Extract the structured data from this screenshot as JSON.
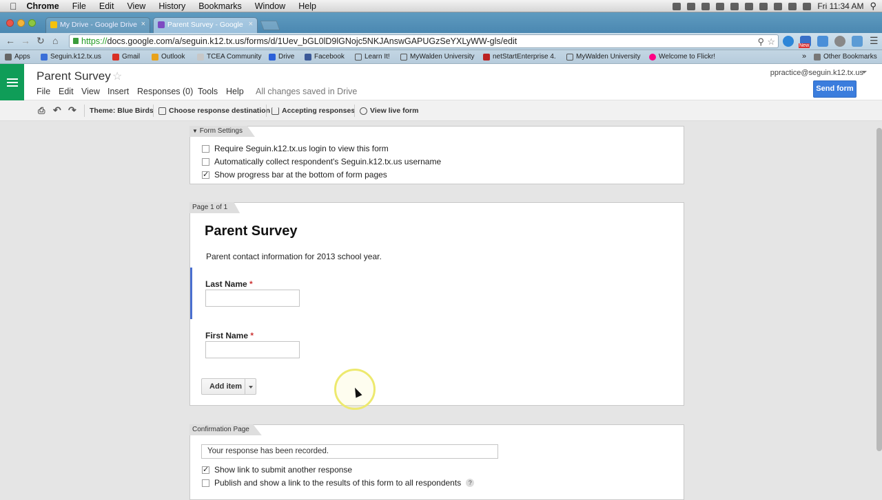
{
  "mac_menu": {
    "app": "Chrome",
    "items": [
      "File",
      "Edit",
      "View",
      "History",
      "Bookmarks",
      "Window",
      "Help"
    ],
    "clock": "Fri 11:34 AM"
  },
  "tabs": [
    {
      "label": "My Drive - Google Drive",
      "active": false
    },
    {
      "label": "Parent Survey - Google",
      "active": true
    }
  ],
  "address": {
    "scheme": "https://",
    "url": "docs.google.com/a/seguin.k12.tx.us/forms/d/1Uev_bGL0lD9lGNojc5NKJAnswGAPUGzSeYXLyWW-gls/edit"
  },
  "extensions": {
    "badge": "New"
  },
  "bookmarks": [
    "Apps",
    "Seguin.k12.tx.us",
    "Gmail",
    "Outlook",
    "TCEA Community",
    "Drive",
    "Facebook",
    "Learn It!",
    "MyWalden University",
    "netStartEnterprise 4.",
    "MyWalden University",
    "Welcome to Flickr!"
  ],
  "bookmarks_overflow": "»",
  "other_bookmarks": "Other Bookmarks",
  "doc": {
    "title": "Parent Survey",
    "menus": [
      "File",
      "Edit",
      "View",
      "Insert",
      "Responses (0)",
      "Tools",
      "Help"
    ],
    "saved_status": "All changes saved in Drive",
    "account": "ppractice@seguin.k12.tx.us",
    "send_label": "Send form"
  },
  "form_toolbar": {
    "theme": "Theme: Blue Birds",
    "destination": "Choose response destination",
    "accepting": "Accepting responses",
    "live": "View live form"
  },
  "form_settings": {
    "tab": "Form Settings",
    "options": [
      {
        "label": "Require Seguin.k12.tx.us login to view this form",
        "checked": false
      },
      {
        "label": "Automatically collect respondent's Seguin.k12.tx.us username",
        "checked": false
      },
      {
        "label": "Show progress bar at the bottom of form pages",
        "checked": true
      }
    ]
  },
  "page": {
    "tab": "Page 1 of 1",
    "title": "Parent Survey",
    "description": "Parent contact information for 2013 school year.",
    "questions": [
      {
        "label": "Last Name",
        "required": "*"
      },
      {
        "label": "First Name",
        "required": "*"
      }
    ],
    "add_item": "Add item"
  },
  "confirmation": {
    "tab": "Confirmation Page",
    "message": "Your response has been recorded.",
    "options": [
      {
        "label": "Show link to submit another response",
        "checked": true
      },
      {
        "label": "Publish and show a link to the results of this form to all respondents",
        "checked": false
      }
    ],
    "help": "?"
  },
  "colors": {
    "drive_green": "#0f9d58",
    "send_blue": "#3b7ddd",
    "chrome_tab": "#4b88b1",
    "focus_bar": "#4a6fd0"
  }
}
